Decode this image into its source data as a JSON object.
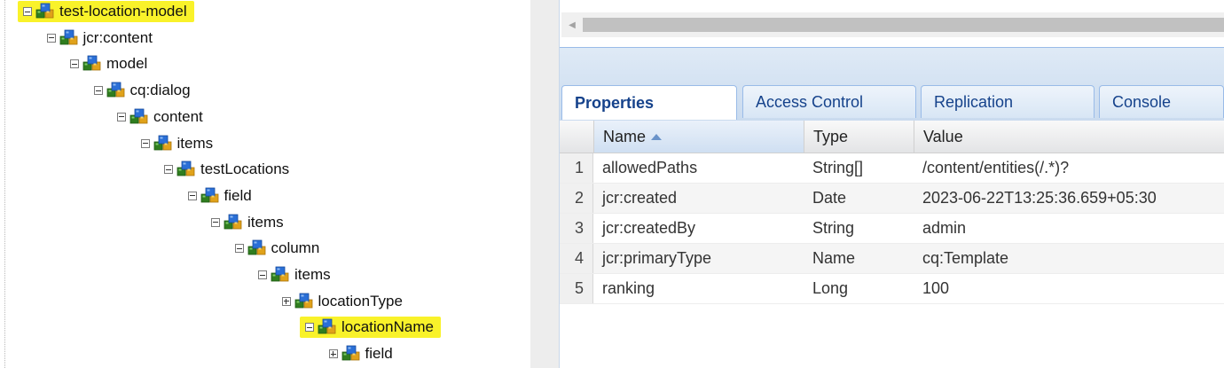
{
  "tree": {
    "nodes": [
      {
        "label": "test-location-model",
        "toggle": "minus",
        "highlighted": true
      },
      {
        "label": "jcr:content",
        "toggle": "minus",
        "highlighted": false
      },
      {
        "label": "model",
        "toggle": "minus",
        "highlighted": false
      },
      {
        "label": "cq:dialog",
        "toggle": "minus",
        "highlighted": false
      },
      {
        "label": "content",
        "toggle": "minus",
        "highlighted": false
      },
      {
        "label": "items",
        "toggle": "minus",
        "highlighted": false
      },
      {
        "label": "testLocations",
        "toggle": "minus",
        "highlighted": false
      },
      {
        "label": "field",
        "toggle": "minus",
        "highlighted": false
      },
      {
        "label": "items",
        "toggle": "minus",
        "highlighted": false
      },
      {
        "label": "column",
        "toggle": "minus",
        "highlighted": false
      },
      {
        "label": "items",
        "toggle": "minus",
        "highlighted": false
      },
      {
        "label": "locationType",
        "toggle": "plus",
        "highlighted": false
      },
      {
        "label": "locationName",
        "toggle": "minus",
        "highlighted": true
      },
      {
        "label": "field",
        "toggle": "plus",
        "highlighted": false
      }
    ],
    "node_icon": "jcr-node-icon",
    "highlight_color": "#f9f22a"
  },
  "tabs": [
    {
      "label": "Properties",
      "active": true
    },
    {
      "label": "Access Control",
      "active": false
    },
    {
      "label": "Replication",
      "active": false
    },
    {
      "label": "Console",
      "active": false
    }
  ],
  "grid": {
    "columns": {
      "name": "Name",
      "type": "Type",
      "value": "Value"
    },
    "sort_icon": "sort-ascending-icon",
    "rows": [
      {
        "num": "1",
        "name": "allowedPaths",
        "type": "String[]",
        "value": "/content/entities(/.*)?"
      },
      {
        "num": "2",
        "name": "jcr:created",
        "type": "Date",
        "value": "2023-06-22T13:25:36.659+05:30"
      },
      {
        "num": "3",
        "name": "jcr:createdBy",
        "type": "String",
        "value": "admin"
      },
      {
        "num": "4",
        "name": "jcr:primaryType",
        "type": "Name",
        "value": "cq:Template"
      },
      {
        "num": "5",
        "name": "ranking",
        "type": "Long",
        "value": "100"
      }
    ]
  },
  "colors": {
    "accent_text": "#15428b",
    "panel_border": "#99bbe8"
  }
}
